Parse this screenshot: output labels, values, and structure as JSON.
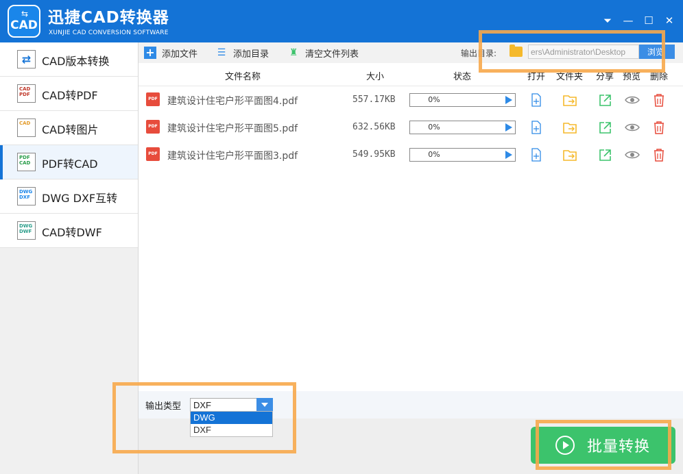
{
  "window": {
    "title": "迅捷CAD转换器",
    "subtitle": "XUNJIE CAD CONVERSION SOFTWARE",
    "logo_text": "CAD",
    "logo_arrows": "⇆"
  },
  "window_controls": {
    "menu": "⏷",
    "minimize": "—",
    "maximize": "☐",
    "close": "✕"
  },
  "sidebar": {
    "items": [
      {
        "label": "CAD版本转换",
        "icon": "version-convert-icon",
        "icon_text": "⇄",
        "active": false
      },
      {
        "label": "CAD转PDF",
        "icon": "cad-to-pdf-icon",
        "icon_text": "CAD PDF",
        "active": false
      },
      {
        "label": "CAD转图片",
        "icon": "cad-to-image-icon",
        "icon_text": "CAD",
        "active": false
      },
      {
        "label": "PDF转CAD",
        "icon": "pdf-to-cad-icon",
        "icon_text": "PDF CAD",
        "active": true
      },
      {
        "label": "DWG DXF互转",
        "icon": "dwg-dxf-icon",
        "icon_text": "DWG DXF",
        "active": false
      },
      {
        "label": "CAD转DWF",
        "icon": "cad-to-dwf-icon",
        "icon_text": "DWG DWF",
        "active": false
      }
    ]
  },
  "toolbar": {
    "add_file": "添加文件",
    "add_folder": "添加目录",
    "clear_list": "清空文件列表",
    "output_dir_label": "输出目录:",
    "output_path": "ers\\Administrator\\Desktop",
    "browse": "浏览"
  },
  "table": {
    "headers": {
      "name": "文件名称",
      "size": "大小",
      "status": "状态",
      "open": "打开",
      "folder": "文件夹",
      "share": "分享",
      "preview": "预览",
      "delete": "删除"
    },
    "rows": [
      {
        "icon_text": "PDF",
        "name": "建筑设计住宅户形平面图4.pdf",
        "size": "557.17KB",
        "progress": "0%",
        "progress_value": 0
      },
      {
        "icon_text": "PDF",
        "name": "建筑设计住宅户形平面图5.pdf",
        "size": "632.56KB",
        "progress": "0%",
        "progress_value": 0
      },
      {
        "icon_text": "PDF",
        "name": "建筑设计住宅户形平面图3.pdf",
        "size": "549.95KB",
        "progress": "0%",
        "progress_value": 0
      }
    ]
  },
  "output_type": {
    "label": "输出类型",
    "selected": "DXF",
    "options": [
      "DWG",
      "DXF"
    ],
    "highlighted": "DWG"
  },
  "convert_button": {
    "label": "批量转换"
  },
  "colors": {
    "primary": "#1473d6",
    "convert_green": "#3cc36c",
    "highlight_orange": "#f7a94b",
    "pdf_red": "#e74c3c",
    "folder_yellow": "#f5b92b"
  }
}
